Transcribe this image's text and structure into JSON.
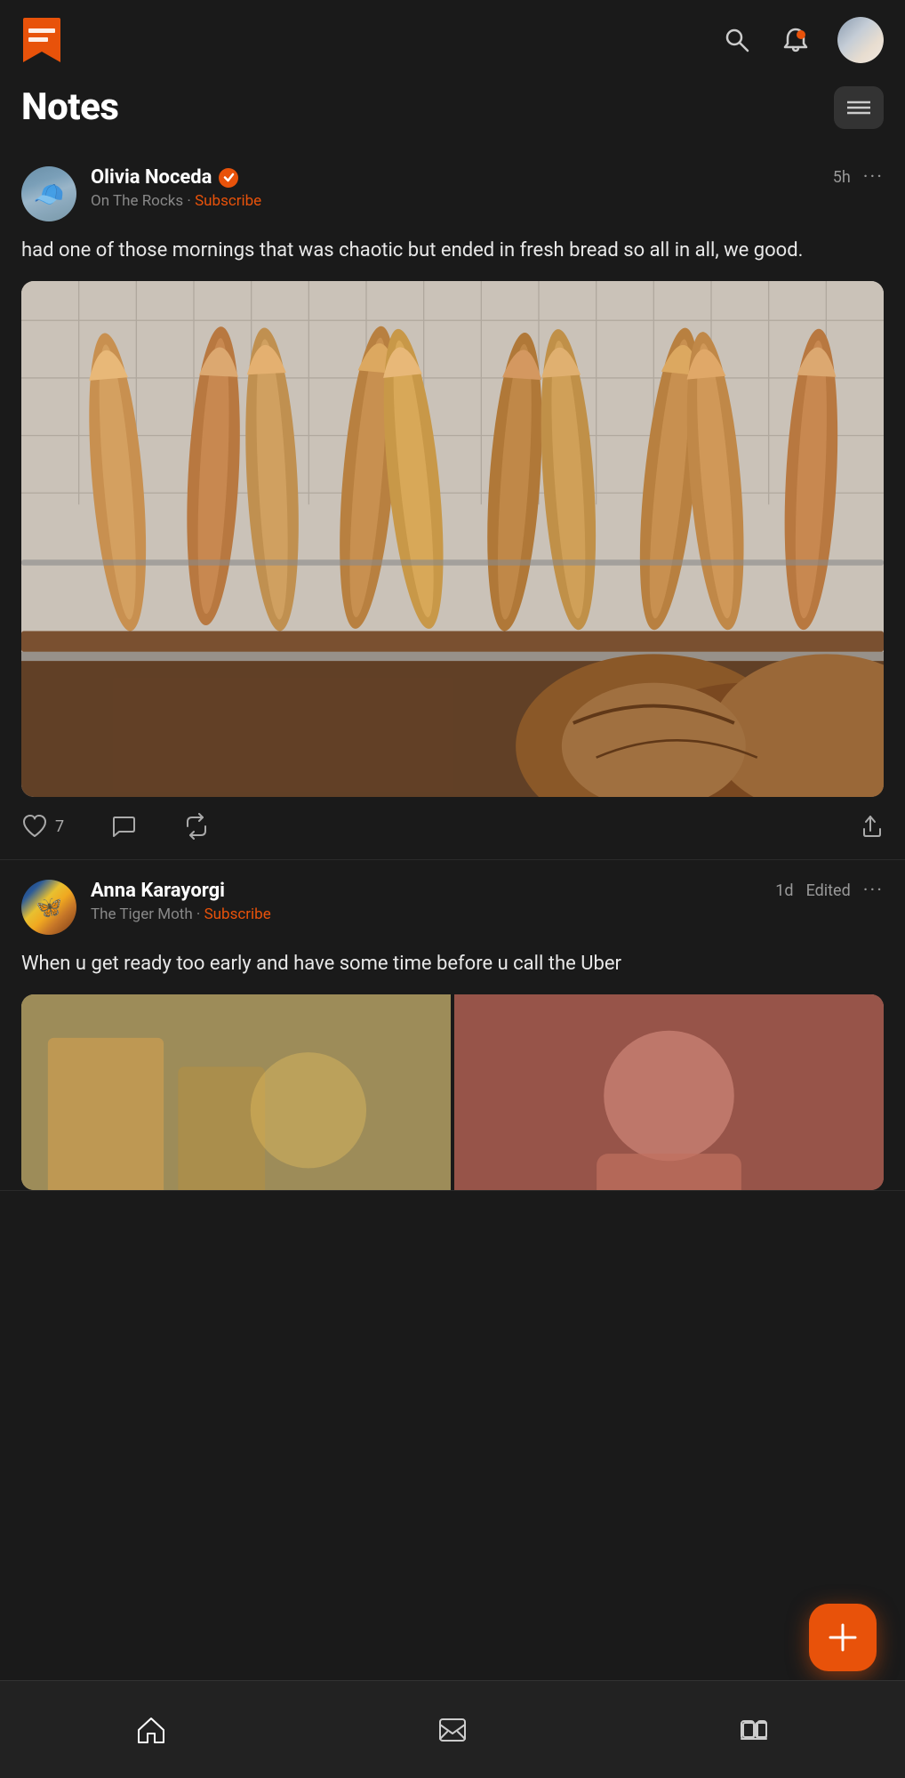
{
  "app": {
    "title": "Notes",
    "brand_color": "#e8520a"
  },
  "top_nav": {
    "search_label": "Search",
    "notifications_label": "Notifications",
    "profile_label": "Profile"
  },
  "page": {
    "title": "Notes",
    "menu_label": "Menu"
  },
  "posts": [
    {
      "id": "post-1",
      "author": "Olivia Noceda",
      "verified": true,
      "publication": "On The Rocks",
      "subscribe_label": "Subscribe",
      "time": "5h",
      "edited": false,
      "more_label": "···",
      "body": "had one of those mornings that was chaotic but ended in fresh bread so all in all, we good.",
      "has_image": true,
      "image_alt": "Fresh bread loaves on bakery shelf",
      "actions": {
        "like_count": "7",
        "comment_label": "Comment",
        "repost_label": "Repost",
        "share_label": "Share"
      }
    },
    {
      "id": "post-2",
      "author": "Anna Karayorgi",
      "verified": false,
      "publication": "The Tiger Moth",
      "subscribe_label": "Subscribe",
      "time": "1d",
      "edited": true,
      "edited_label": "Edited",
      "more_label": "···",
      "body": "When u get ready too early and have some time before u call the Uber",
      "has_images": true
    }
  ],
  "bottom_nav": {
    "home_label": "Home",
    "inbox_label": "Inbox",
    "activity_label": "Activity"
  },
  "fab": {
    "label": "+"
  }
}
